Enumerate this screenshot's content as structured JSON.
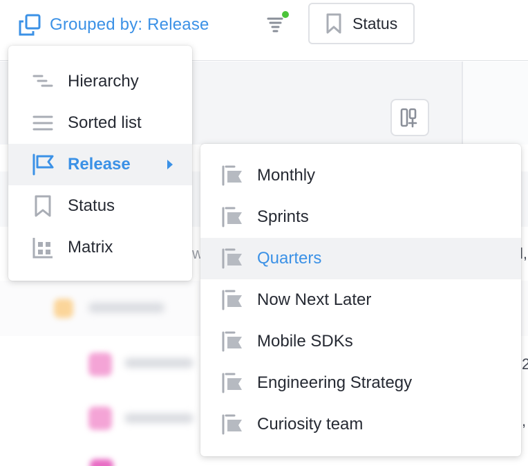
{
  "toolbar": {
    "grouped_label": "Grouped by: Release",
    "filter_icon": "filter-icon",
    "filter_active_color": "#4cc43a",
    "status_button_label": "Status"
  },
  "group_menu": {
    "items": [
      {
        "label": "Hierarchy",
        "icon": "hierarchy-icon"
      },
      {
        "label": "Sorted list",
        "icon": "list-icon"
      },
      {
        "label": "Release",
        "icon": "release-flag-icon",
        "selected": true,
        "has_submenu": true
      },
      {
        "label": "Status",
        "icon": "bookmark-icon"
      },
      {
        "label": "Matrix",
        "icon": "matrix-icon"
      }
    ]
  },
  "release_submenu": {
    "items": [
      {
        "label": "Monthly"
      },
      {
        "label": "Sprints"
      },
      {
        "label": "Quarters",
        "highlighted": true
      },
      {
        "label": "Now Next Later"
      },
      {
        "label": "Mobile SDKs"
      },
      {
        "label": "Engineering Strategy"
      },
      {
        "label": "Curiosity team"
      }
    ]
  },
  "background": {
    "edge_text_1": "l,",
    "edge_text_2": "2",
    "edge_text_3": ","
  },
  "colors": {
    "accent": "#3b91e6",
    "icon_gray": "#a9adb5"
  }
}
